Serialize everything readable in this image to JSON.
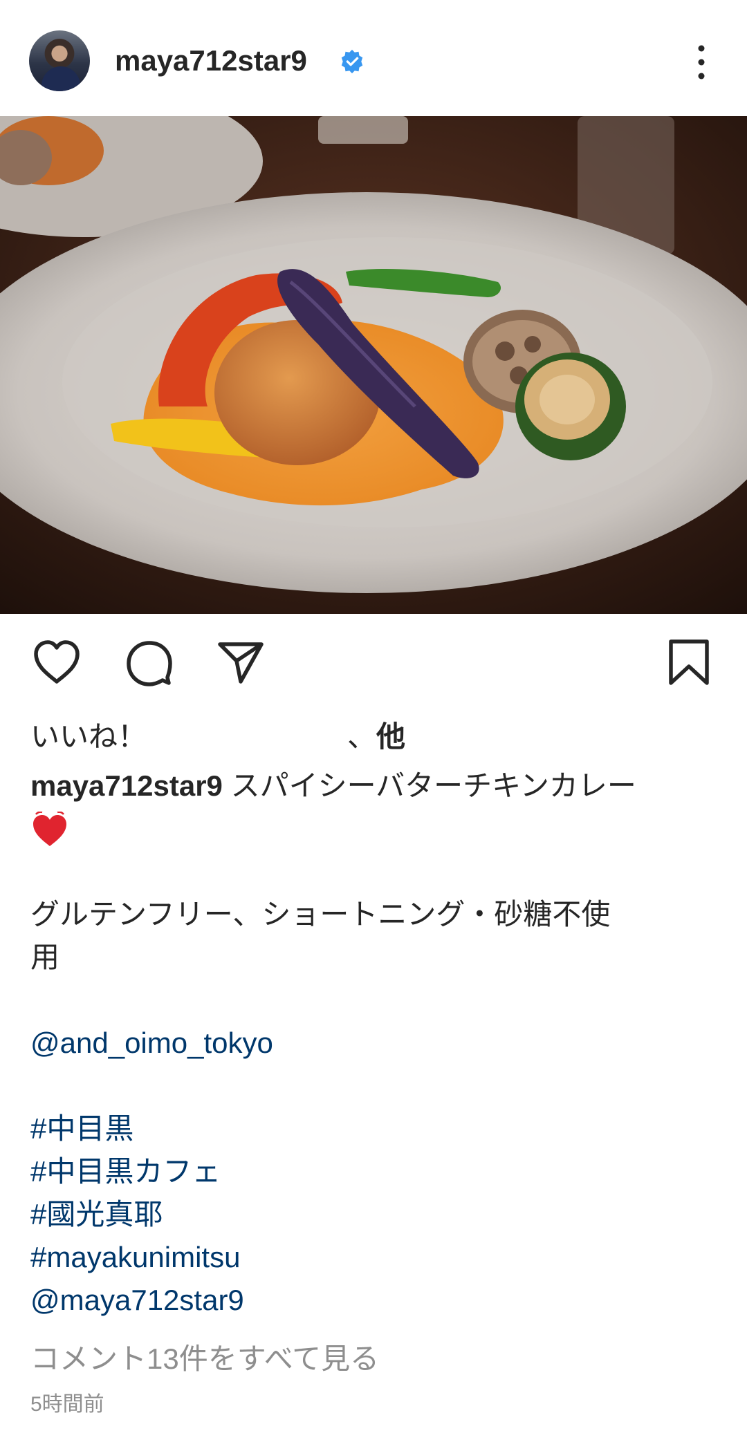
{
  "post": {
    "username": "maya712star9",
    "verified": true,
    "likes_prefix": "いいね！",
    "likes_separator": "、",
    "likes_suffix": "他",
    "caption": {
      "username": "maya712star9",
      "title": "スパイシーバターチキンカレー",
      "line2": "グルテンフリー、ショートニング・砂糖不使",
      "line3": "用",
      "mention": "@and_oimo_tokyo",
      "tags": [
        "#中目黒",
        "#中目黒カフェ",
        "#國光真耶",
        "#mayakunimitsu"
      ],
      "mention2": "@maya712star9"
    },
    "comments_link": "コメント13件をすべて見る",
    "timestamp": "5時間前"
  },
  "icons": {
    "verified": "verified-badge-icon",
    "more": "more-vertical-icon",
    "like": "heart-outline-icon",
    "comment": "comment-bubble-icon",
    "share": "paper-plane-icon",
    "save": "bookmark-icon",
    "emoji": "heart-emoji-icon"
  },
  "colors": {
    "verified_blue": "#3897f0",
    "link_blue": "#00376b",
    "muted": "#8e8e8e",
    "text": "#262626"
  }
}
